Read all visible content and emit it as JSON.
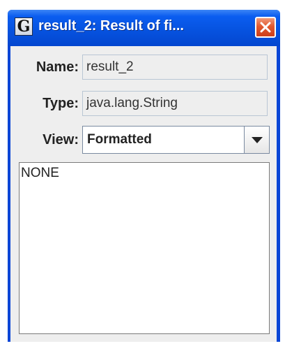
{
  "window": {
    "title": "result_2: Result of fi...",
    "icon_letter": "G",
    "icon_name": "app-g-icon",
    "close_icon": "close-icon"
  },
  "fields": {
    "name_label": "Name:",
    "name_value": "result_2",
    "type_label": "Type:",
    "type_value": "java.lang.String",
    "view_label": "View:",
    "view_selected": "Formatted",
    "view_dropdown_icon": "chevron-down-icon"
  },
  "content": {
    "text": "NONE"
  },
  "colors": {
    "titlebar": "#0653e0",
    "close_button": "#e2592f",
    "client_background": "#eeeeee"
  }
}
